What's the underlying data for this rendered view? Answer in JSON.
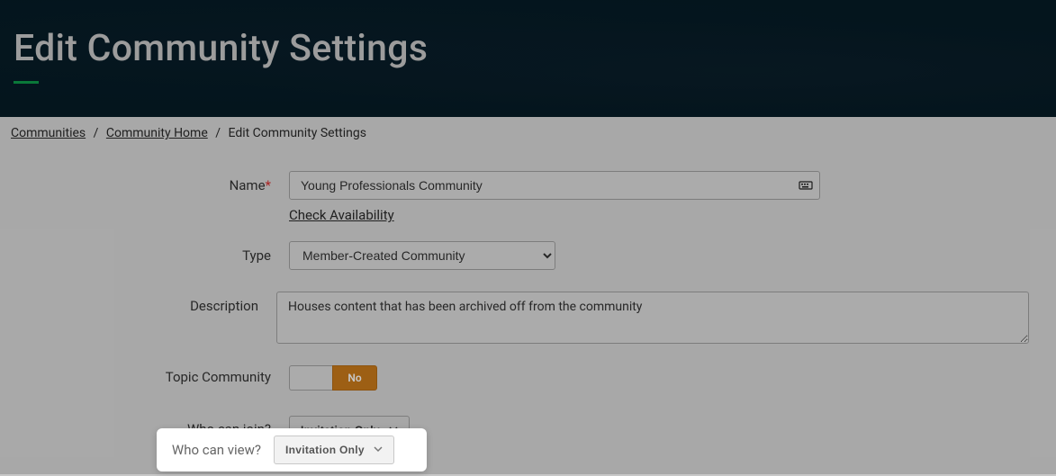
{
  "hero": {
    "title": "Edit Community Settings"
  },
  "breadcrumb": {
    "items": [
      "Communities",
      "Community Home",
      "Edit Community Settings"
    ]
  },
  "form": {
    "name": {
      "label": "Name",
      "value": "Young Professionals Community",
      "check_link": "Check Availability "
    },
    "type": {
      "label": "Type",
      "value": "Member-Created Community"
    },
    "description": {
      "label": "Description",
      "value": "Houses content that has been archived off from the community"
    },
    "topic": {
      "label": "Topic Community",
      "value": "No"
    },
    "join": {
      "label": "Who can join?",
      "value": "Invitation Only"
    },
    "view": {
      "label": "Who can view?",
      "value": "Invitation Only"
    }
  }
}
